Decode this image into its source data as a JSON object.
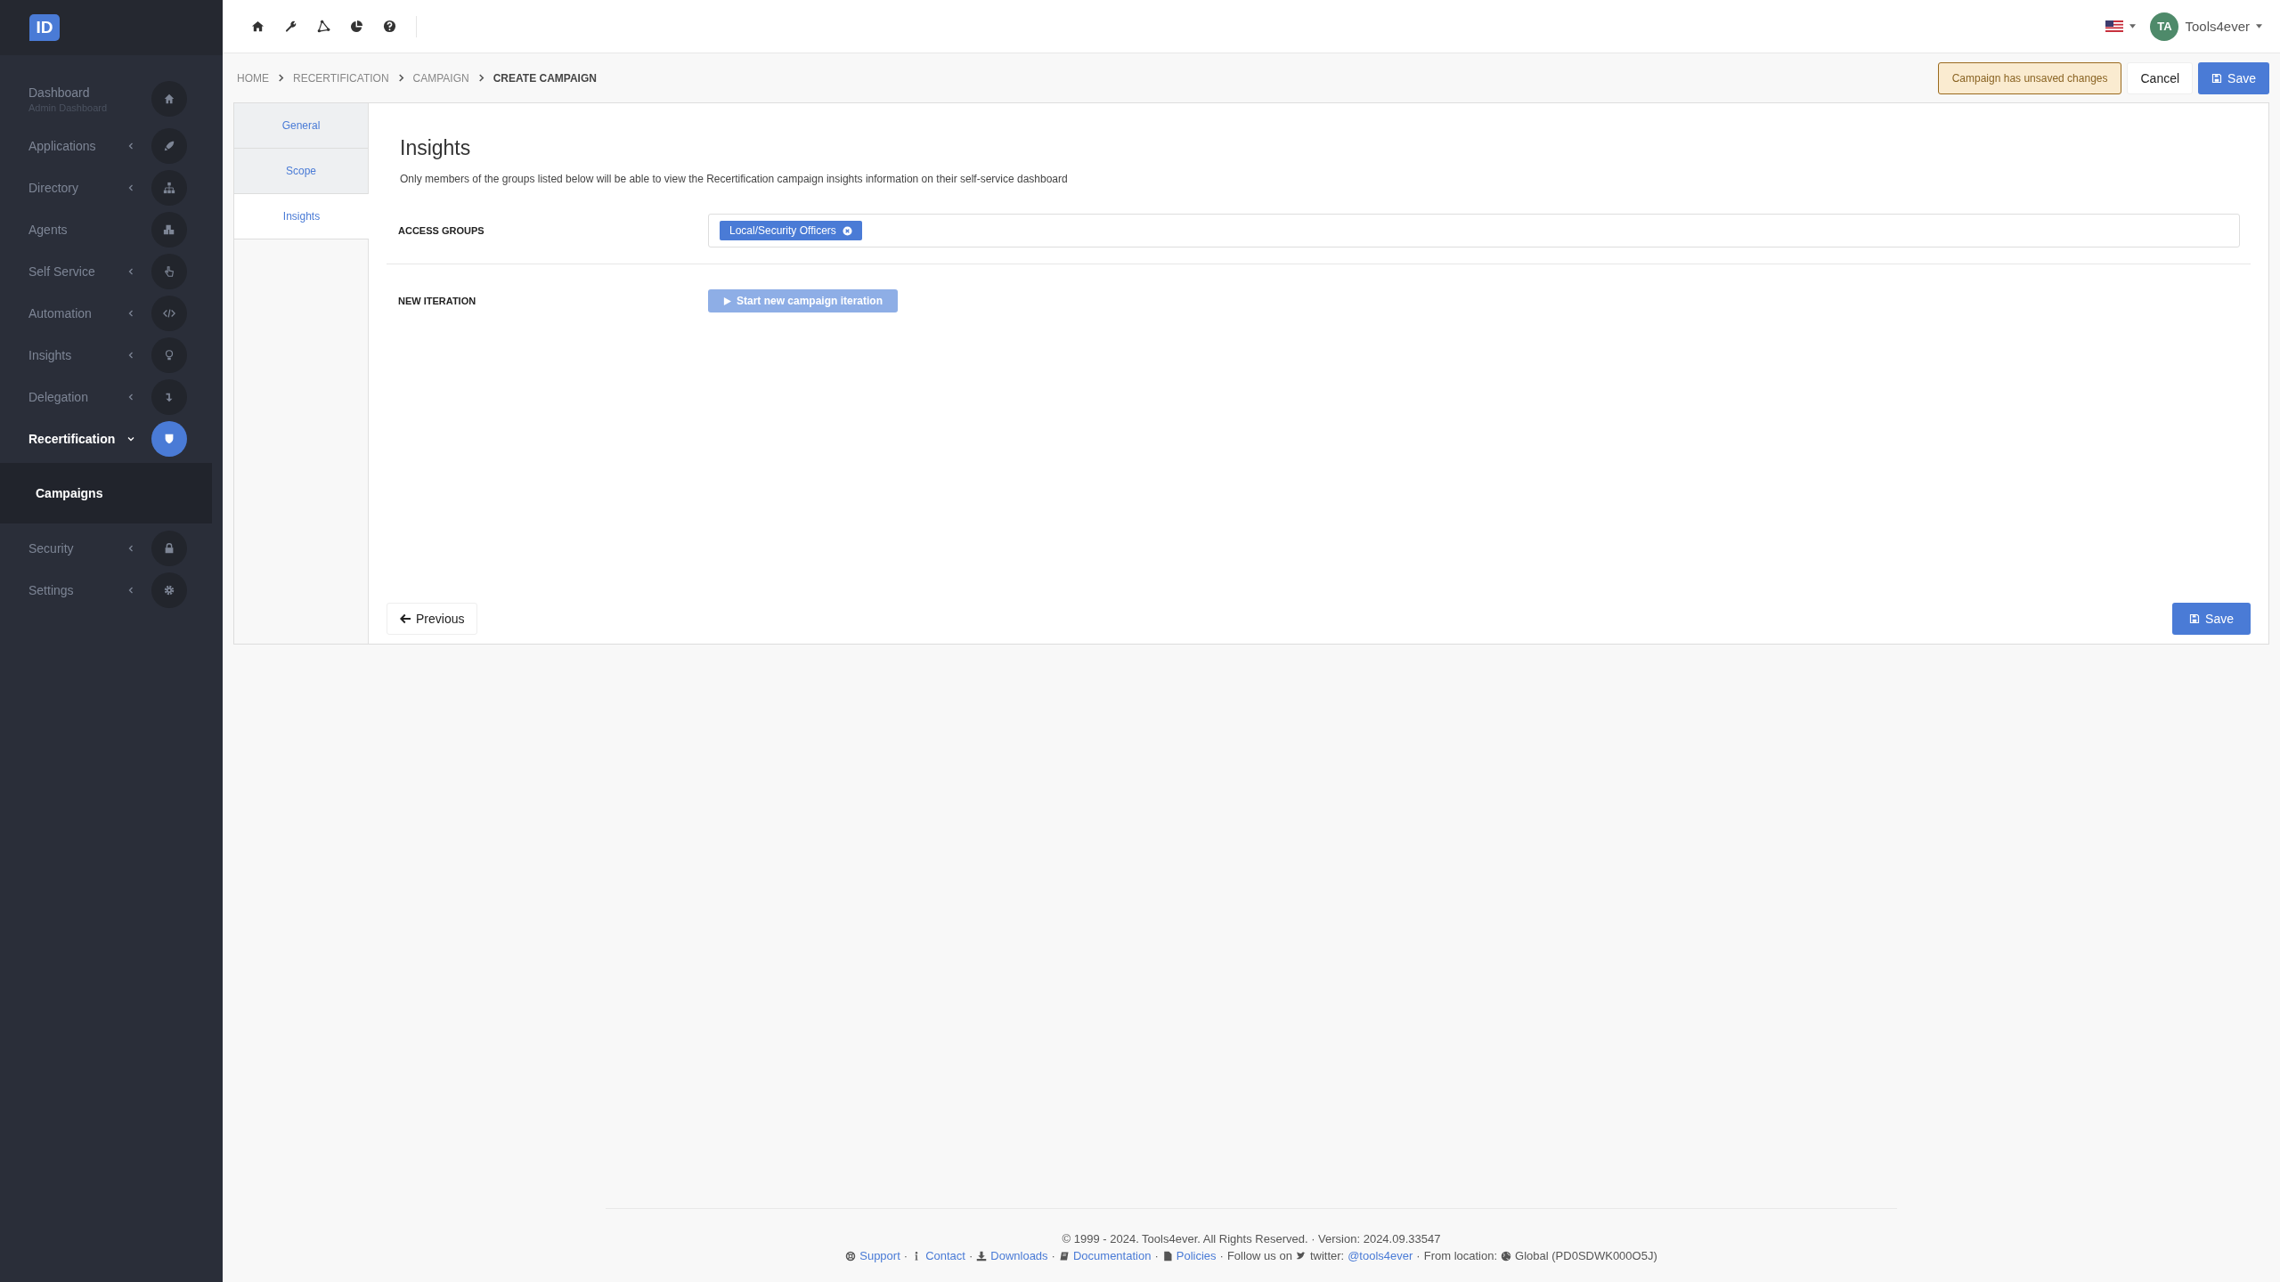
{
  "sidebar": {
    "logo": "ID",
    "items": [
      {
        "label": "Dashboard",
        "sublabel": "Admin Dashboard",
        "kind": "link",
        "selected": false
      },
      {
        "label": "Applications",
        "kind": "group",
        "expanded": false,
        "selected": false
      },
      {
        "label": "Directory",
        "kind": "group",
        "expanded": false,
        "selected": false
      },
      {
        "label": "Agents",
        "kind": "link",
        "selected": false
      },
      {
        "label": "Self Service",
        "kind": "group",
        "expanded": false,
        "selected": false
      },
      {
        "label": "Automation",
        "kind": "group",
        "expanded": false,
        "selected": false
      },
      {
        "label": "Insights",
        "kind": "group",
        "expanded": false,
        "selected": false
      },
      {
        "label": "Delegation",
        "kind": "group",
        "expanded": false,
        "selected": false
      },
      {
        "label": "Recertification",
        "kind": "group",
        "expanded": true,
        "selected": true,
        "children": [
          {
            "label": "Campaigns",
            "selected": true
          }
        ]
      },
      {
        "label": "Security",
        "kind": "group",
        "expanded": false,
        "selected": false
      },
      {
        "label": "Settings",
        "kind": "group",
        "expanded": false,
        "selected": false
      }
    ]
  },
  "user": {
    "initials": "TA",
    "name": "Tools4ever"
  },
  "breadcrumb": [
    {
      "label": "HOME",
      "selected": false
    },
    {
      "label": "RECERTIFICATION",
      "selected": false
    },
    {
      "label": "CAMPAIGN",
      "selected": false
    },
    {
      "label": "CREATE CAMPAIGN",
      "selected": true
    }
  ],
  "status": "Campaign has unsaved changes",
  "header_buttons": {
    "cancel": "Cancel",
    "save": "Save"
  },
  "tabs": [
    {
      "label": "General",
      "selected": false
    },
    {
      "label": "Scope",
      "selected": false
    },
    {
      "label": "Insights",
      "selected": true
    }
  ],
  "section": {
    "title": "Insights",
    "description": "Only members of the groups listed below will be able to view the Recertification campaign insights information on their self-service dashboard",
    "fields": [
      {
        "label": "ACCESS GROUPS",
        "kind": "tags",
        "tags": [
          "Local/Security Officers"
        ]
      },
      {
        "label": "NEW ITERATION",
        "kind": "button",
        "button": {
          "label": "Start new campaign iteration",
          "disabled": true
        }
      }
    ]
  },
  "form_buttons": {
    "previous": "Previous",
    "save": "Save"
  },
  "footer": {
    "copyright": "© 1999 - 2024. Tools4ever. All Rights Reserved. · Version: 2024.09.33547",
    "separator": "·",
    "groups": [
      [
        {
          "kind": "link",
          "text": "Support"
        }
      ],
      [
        {
          "kind": "link",
          "text": "Contact"
        }
      ],
      [
        {
          "kind": "link",
          "text": "Downloads"
        }
      ],
      [
        {
          "kind": "link",
          "text": "Documentation"
        }
      ],
      [
        {
          "kind": "link",
          "text": "Policies"
        }
      ],
      [
        {
          "kind": "text",
          "text": "Follow us on"
        },
        {
          "kind": "text",
          "text": "twitter:"
        },
        {
          "kind": "link",
          "text": "@tools4ever"
        }
      ],
      [
        {
          "kind": "text",
          "text": "From location:"
        },
        {
          "kind": "text",
          "text": "Global (PD0SDWK000O5J)"
        }
      ]
    ]
  }
}
